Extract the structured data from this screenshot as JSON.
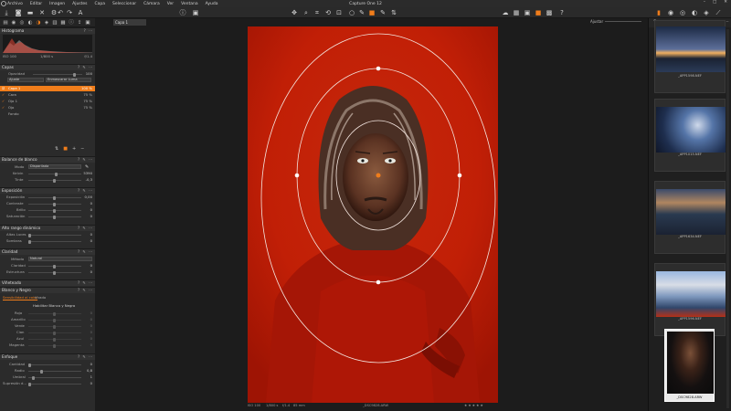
{
  "app": {
    "title": "Capture One 12"
  },
  "menu": [
    "Archivo",
    "Editar",
    "Imagen",
    "Ajustes",
    "Capa",
    "Seleccionar",
    "Cámara",
    "Ver",
    "Ventana",
    "Ayuda"
  ],
  "left_panel": {
    "histogram": {
      "title": "Histograma",
      "iso": "ISO 100",
      "shutter": "1/800 s",
      "aperture": "f/1.4"
    },
    "layers": {
      "title": "Capas",
      "opacity_label": "Opacidad",
      "opacity_value": "100",
      "mode_value": "Ajuste",
      "method_value": "Enmascarar Luma",
      "items": [
        {
          "name": "Capa 1",
          "value": "100 %"
        },
        {
          "name": "Cara",
          "value": "75 %"
        },
        {
          "name": "Ojo 1",
          "value": "75 %"
        },
        {
          "name": "Ojo",
          "value": "75 %"
        },
        {
          "name": "Fondo",
          "value": ""
        }
      ]
    },
    "white_balance": {
      "title": "Balance de blanco",
      "mode_label": "Modo",
      "mode_value": "Disparilada",
      "kelvin_label": "Kelvin",
      "kelvin_value": "5390",
      "tint_label": "Tinte",
      "tint_value": "-0,3"
    },
    "exposure": {
      "title": "Exposición",
      "rows": [
        {
          "label": "Exposición",
          "value": "0,00"
        },
        {
          "label": "Contraste",
          "value": "0"
        },
        {
          "label": "Brillo",
          "value": "0"
        },
        {
          "label": "Saturación",
          "value": "0"
        }
      ]
    },
    "hdr": {
      "title": "Alto rango dinámico",
      "rows": [
        {
          "label": "Altas Luces",
          "value": "0"
        },
        {
          "label": "Sombras",
          "value": "0"
        }
      ]
    },
    "clarity": {
      "title": "Claridad",
      "method_label": "Método",
      "method_value": "Natural",
      "rows": [
        {
          "label": "Claridad",
          "value": "0"
        },
        {
          "label": "Estructura",
          "value": "0"
        }
      ]
    },
    "vignette": {
      "title": "Viñeteado"
    },
    "bw": {
      "title": "Blanco y Negro",
      "tab1": "Sensibilidad al color",
      "tab2": "Virado",
      "enable": "Habilitar Blanco y Negro",
      "rows": [
        {
          "label": "Rojo",
          "value": "0"
        },
        {
          "label": "Amarillo",
          "value": "0"
        },
        {
          "label": "Verde",
          "value": "0"
        },
        {
          "label": "Cian",
          "value": "0"
        },
        {
          "label": "Azul",
          "value": "0"
        },
        {
          "label": "Magenta",
          "value": "0"
        }
      ]
    },
    "sharpening": {
      "title": "Enfoque",
      "rows": [
        {
          "label": "Cantidad",
          "value": "0"
        },
        {
          "label": "Radio",
          "value": "0,8"
        },
        {
          "label": "Umbral",
          "value": "1"
        },
        {
          "label": "Supresión d...",
          "value": "0"
        }
      ]
    }
  },
  "viewer": {
    "variant_tab": "Capa 1",
    "fit_label": "Ajustar",
    "counter": "1/11",
    "status": {
      "iso": "ISO 100",
      "shutter": "1/800 s",
      "aperture": "f/1.4",
      "focal": "85 mm",
      "filename": "_DSC9828.ARW",
      "stars": "★ ★ ★ ★ ★"
    }
  },
  "filmstrip": {
    "thumbs": [
      {
        "name": "_APP1598.NEF"
      },
      {
        "name": "_APP1015.NEF"
      },
      {
        "name": "_APP1634.NEF"
      },
      {
        "name": "_APP1596.NEF"
      },
      {
        "name": "_DSC9828.ARW"
      }
    ]
  }
}
